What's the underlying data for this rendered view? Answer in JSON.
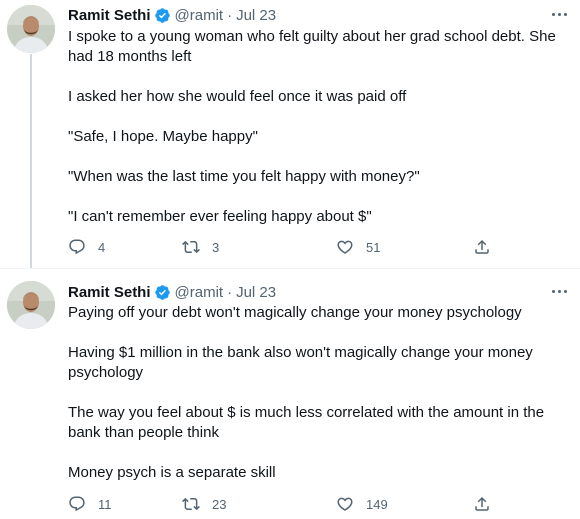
{
  "tweets": [
    {
      "author_name": "Ramit Sethi",
      "handle": "@ramit",
      "separator": "·",
      "date": "Jul 23",
      "paragraphs": [
        "I spoke to a young woman who felt guilty about her grad school debt. She had 18 months left",
        "I asked her how she would feel once it was paid off",
        "\"Safe, I hope. Maybe happy\"",
        "\"When was the last time you felt happy with money?\"",
        "\"I can't remember ever feeling happy about $\""
      ],
      "replies": "4",
      "retweets": "3",
      "likes": "51"
    },
    {
      "author_name": "Ramit Sethi",
      "handle": "@ramit",
      "separator": "·",
      "date": "Jul 23",
      "paragraphs": [
        "Paying off your debt won't magically change your money psychology",
        "Having $1 million in the bank also won't magically change your money psychology",
        "The way you feel about $ is much less correlated with the  amount in the bank than people think",
        "Money psych is a separate skill"
      ],
      "replies": "11",
      "retweets": "23",
      "likes": "149"
    }
  ],
  "icons": {
    "verified": "verified-badge-icon",
    "more": "more-options-icon",
    "reply": "reply-icon",
    "retweet": "retweet-icon",
    "like": "heart-icon",
    "share": "share-icon"
  },
  "colors": {
    "text_primary": "#0f1419",
    "text_secondary": "#536471",
    "verified_blue": "#1d9bf0",
    "thread_line": "#cfd9de"
  }
}
